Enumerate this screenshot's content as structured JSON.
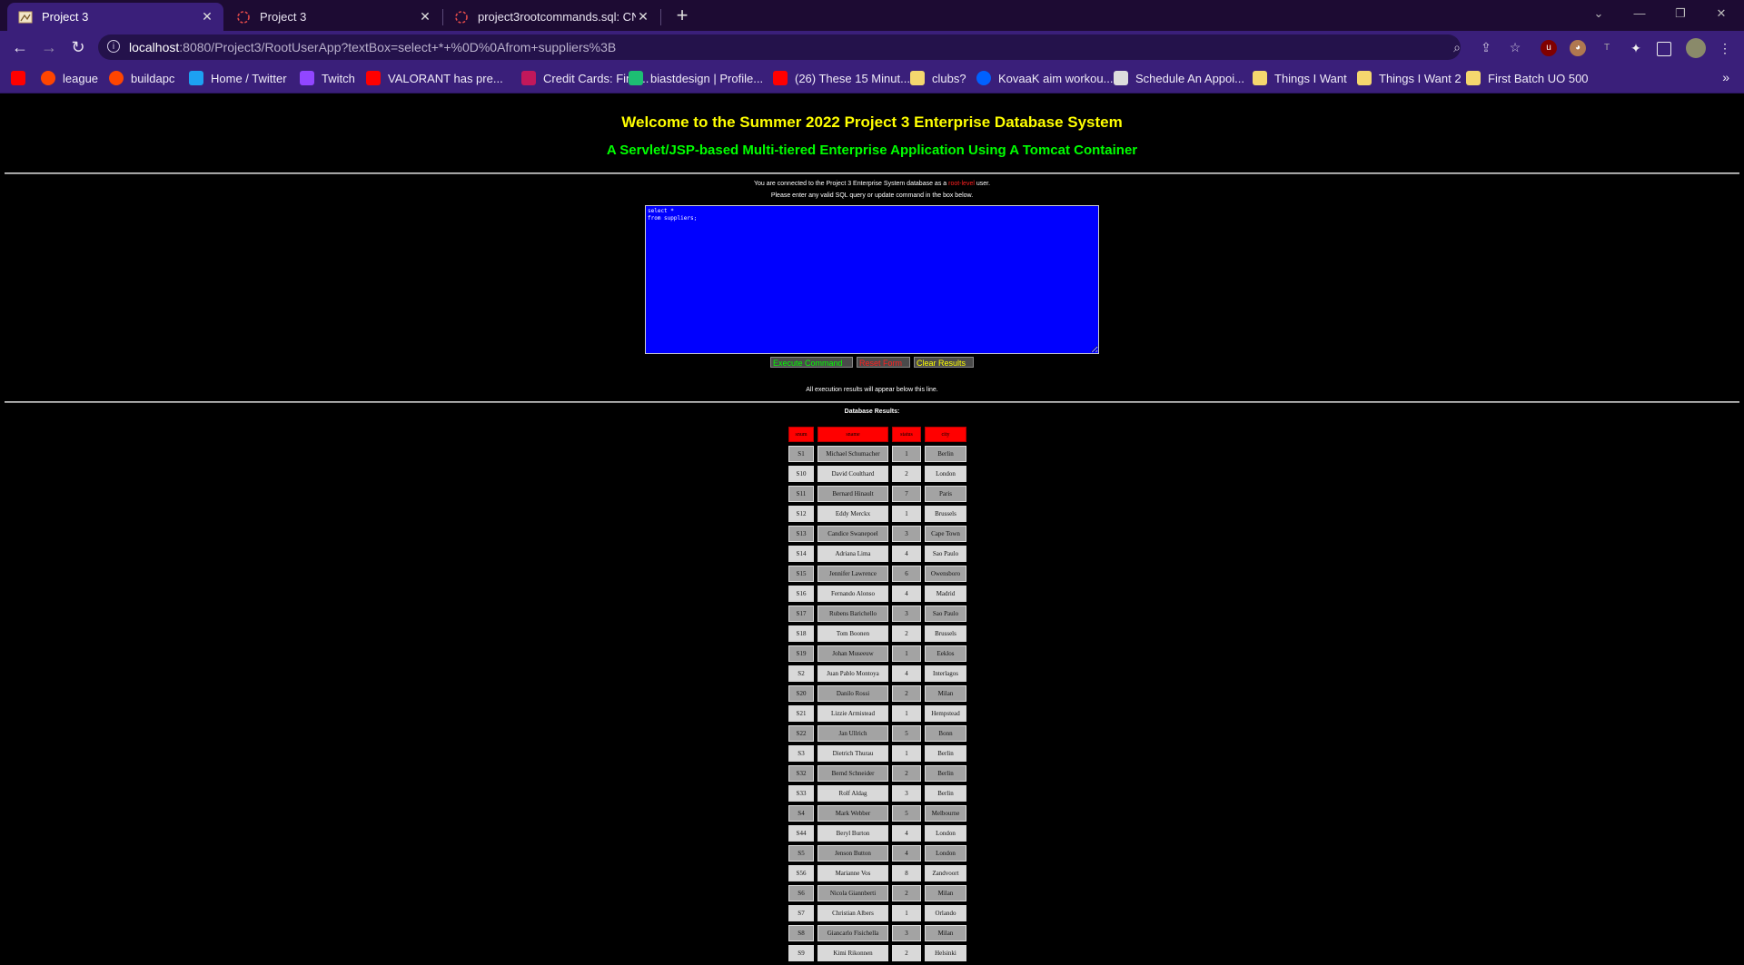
{
  "browser": {
    "tabs": [
      {
        "title": "Project 3",
        "active": true,
        "icon": "page-favicon-icon"
      },
      {
        "title": "Project 3",
        "active": false,
        "icon": "loading-spinner-icon"
      },
      {
        "title": "project3rootcommands.sql: CNT4",
        "active": false,
        "icon": "loading-spinner-icon"
      }
    ],
    "new_tab": "+",
    "url_host": "localhost",
    "url_rest": ":8080/Project3/RootUserApp?textBox=select+*+%0D%0Afrom+suppliers%3B",
    "bookmarks": [
      {
        "label": "",
        "icon": "youtube-icon",
        "color": "#ff0000"
      },
      {
        "label": "league",
        "icon": "reddit-icon",
        "color": "#ff4500"
      },
      {
        "label": "buildapc",
        "icon": "reddit-icon",
        "color": "#ff4500"
      },
      {
        "label": "Home / Twitter",
        "icon": "twitter-icon",
        "color": "#1da1f2"
      },
      {
        "label": "Twitch",
        "icon": "twitch-icon",
        "color": "#9146ff"
      },
      {
        "label": "VALORANT has pre...",
        "icon": "youtube-icon",
        "color": "#ff0000"
      },
      {
        "label": "Credit Cards: Find...",
        "icon": "arrow-icon",
        "color": "#c2185b"
      },
      {
        "label": "biastdesign | Profile...",
        "icon": "fiverr-icon",
        "color": "#1dbf73"
      },
      {
        "label": "(26) These 15 Minut...",
        "icon": "youtube-icon",
        "color": "#ff0000"
      },
      {
        "label": "clubs?",
        "icon": "folder-icon",
        "color": "#f5d76e"
      },
      {
        "label": "KovaaK aim workou...",
        "icon": "dropbox-icon",
        "color": "#0061ff"
      },
      {
        "label": "Schedule An Appoi...",
        "icon": "calendar-icon",
        "color": "#dddddd"
      },
      {
        "label": "Things I Want",
        "icon": "folder-icon",
        "color": "#f5d76e"
      },
      {
        "label": "Things I Want 2",
        "icon": "folder-icon",
        "color": "#f5d76e"
      },
      {
        "label": "First Batch UO 500",
        "icon": "folder-icon",
        "color": "#f5d76e"
      }
    ],
    "more": "»"
  },
  "page": {
    "title": "Welcome to the Summer 2022 Project 3 Enterprise Database System",
    "subtitle": "A Servlet/JSP-based Multi-tiered Enterprise Application Using A Tomcat Container",
    "connected_prefix": "You are connected to the Project 3 Enterprise System database as a ",
    "connected_user": "root-level",
    "connected_suffix": " user.",
    "instruction": "Please enter any valid SQL query or update command in the box below.",
    "query_text": "select *\nfrom suppliers;",
    "buttons": {
      "execute": "Execute Command",
      "reset": "Reset Form",
      "clear": "Clear Results"
    },
    "results_note": "All execution results will appear below this line.",
    "results_heading": "Database Results:",
    "table": {
      "columns": [
        "snum",
        "sname",
        "status",
        "city"
      ],
      "rows": [
        [
          "S1",
          "Michael Schumacher",
          "1",
          "Berlin"
        ],
        [
          "S10",
          "David Coulthard",
          "2",
          "London"
        ],
        [
          "S11",
          "Bernard Hinault",
          "7",
          "Paris"
        ],
        [
          "S12",
          "Eddy Merckx",
          "1",
          "Brussels"
        ],
        [
          "S13",
          "Candice Swanepoel",
          "3",
          "Cape Town"
        ],
        [
          "S14",
          "Adriana Lima",
          "4",
          "Sao Paulo"
        ],
        [
          "S15",
          "Jennifer Lawrence",
          "6",
          "Owensboro"
        ],
        [
          "S16",
          "Fernando Alonso",
          "4",
          "Madrid"
        ],
        [
          "S17",
          "Rubens Barichello",
          "3",
          "Sao Paulo"
        ],
        [
          "S18",
          "Tom Boonen",
          "2",
          "Brussels"
        ],
        [
          "S19",
          "Johan Museeuw",
          "1",
          "Eeklos"
        ],
        [
          "S2",
          "Juan Pablo Montoya",
          "4",
          "Interlagos"
        ],
        [
          "S20",
          "Danilo Rossi",
          "2",
          "Milan"
        ],
        [
          "S21",
          "Lizzie Armistead",
          "1",
          "Hempstead"
        ],
        [
          "S22",
          "Jan Ullrich",
          "5",
          "Bonn"
        ],
        [
          "S3",
          "Dietrich Thurau",
          "1",
          "Berlin"
        ],
        [
          "S32",
          "Bernd Schneider",
          "2",
          "Berlin"
        ],
        [
          "S33",
          "Rolf Aldag",
          "3",
          "Berlin"
        ],
        [
          "S4",
          "Mark Webber",
          "5",
          "Melbourne"
        ],
        [
          "S44",
          "Beryl Burton",
          "4",
          "London"
        ],
        [
          "S5",
          "Jenson Button",
          "4",
          "London"
        ],
        [
          "S56",
          "Marianne Vos",
          "8",
          "Zandvoort"
        ],
        [
          "S6",
          "Nicola Giannberti",
          "2",
          "Milan"
        ],
        [
          "S7",
          "Christian Albers",
          "1",
          "Orlando"
        ],
        [
          "S8",
          "Giancarlo Fisichella",
          "3",
          "Milan"
        ],
        [
          "S9",
          "Kimi Rikonnen",
          "2",
          "Helsinki"
        ]
      ]
    }
  }
}
